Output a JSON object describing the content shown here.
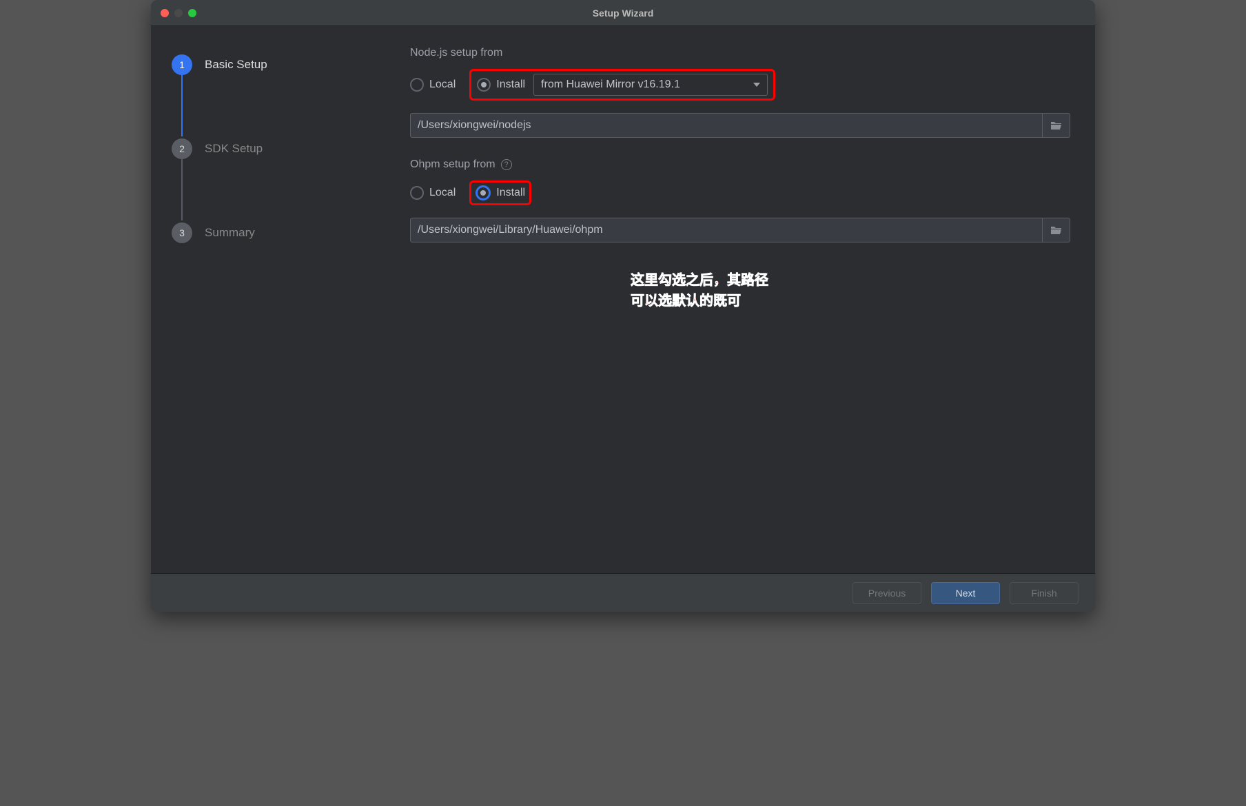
{
  "window": {
    "title": "Setup Wizard"
  },
  "sidebar": {
    "steps": [
      {
        "num": "1",
        "label": "Basic Setup",
        "active": true
      },
      {
        "num": "2",
        "label": "SDK Setup",
        "active": false
      },
      {
        "num": "3",
        "label": "Summary",
        "active": false
      }
    ]
  },
  "main": {
    "node": {
      "section_label": "Node.js setup from",
      "local_label": "Local",
      "install_label": "Install",
      "dropdown_value": "from Huawei Mirror v16.19.1",
      "path": "/Users/xiongwei/nodejs"
    },
    "ohpm": {
      "section_label": "Ohpm setup from",
      "local_label": "Local",
      "install_label": "Install",
      "path": "/Users/xiongwei/Library/Huawei/ohpm"
    },
    "annotation": {
      "line1": "这里勾选之后，其路径",
      "line2": "可以选默认的既可"
    }
  },
  "footer": {
    "previous": "Previous",
    "next": "Next",
    "finish": "Finish"
  }
}
